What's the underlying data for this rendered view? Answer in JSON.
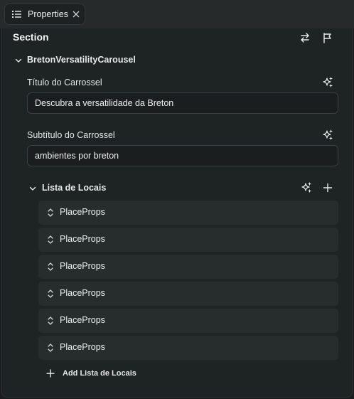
{
  "tab": {
    "label": "Properties"
  },
  "section": {
    "title": "Section"
  },
  "component": {
    "name": "BretonVersatilityCarousel"
  },
  "fields": [
    {
      "label": "Título do Carrossel",
      "value": "Descubra a versatilidade da Breton"
    },
    {
      "label": "Subtítulo do Carrossel",
      "value": "ambientes por breton"
    }
  ],
  "list": {
    "title": "Lista de Locais",
    "items": [
      "PlaceProps",
      "PlaceProps",
      "PlaceProps",
      "PlaceProps",
      "PlaceProps",
      "PlaceProps"
    ],
    "add_label": "Add Lista de Locais"
  },
  "icons": {
    "tab": "list-icon",
    "close": "close-icon",
    "swap": "swap-icon",
    "flag": "flag-icon",
    "ai": "sparkles-icon",
    "add": "plus-icon",
    "reorder": "up-down-chevron-icon",
    "collapse": "chevron-down-icon"
  },
  "colors": {
    "background": "#1e2324",
    "tabbar": "#262a2b",
    "item": "#272c2d",
    "text": "#e8eaeb"
  }
}
